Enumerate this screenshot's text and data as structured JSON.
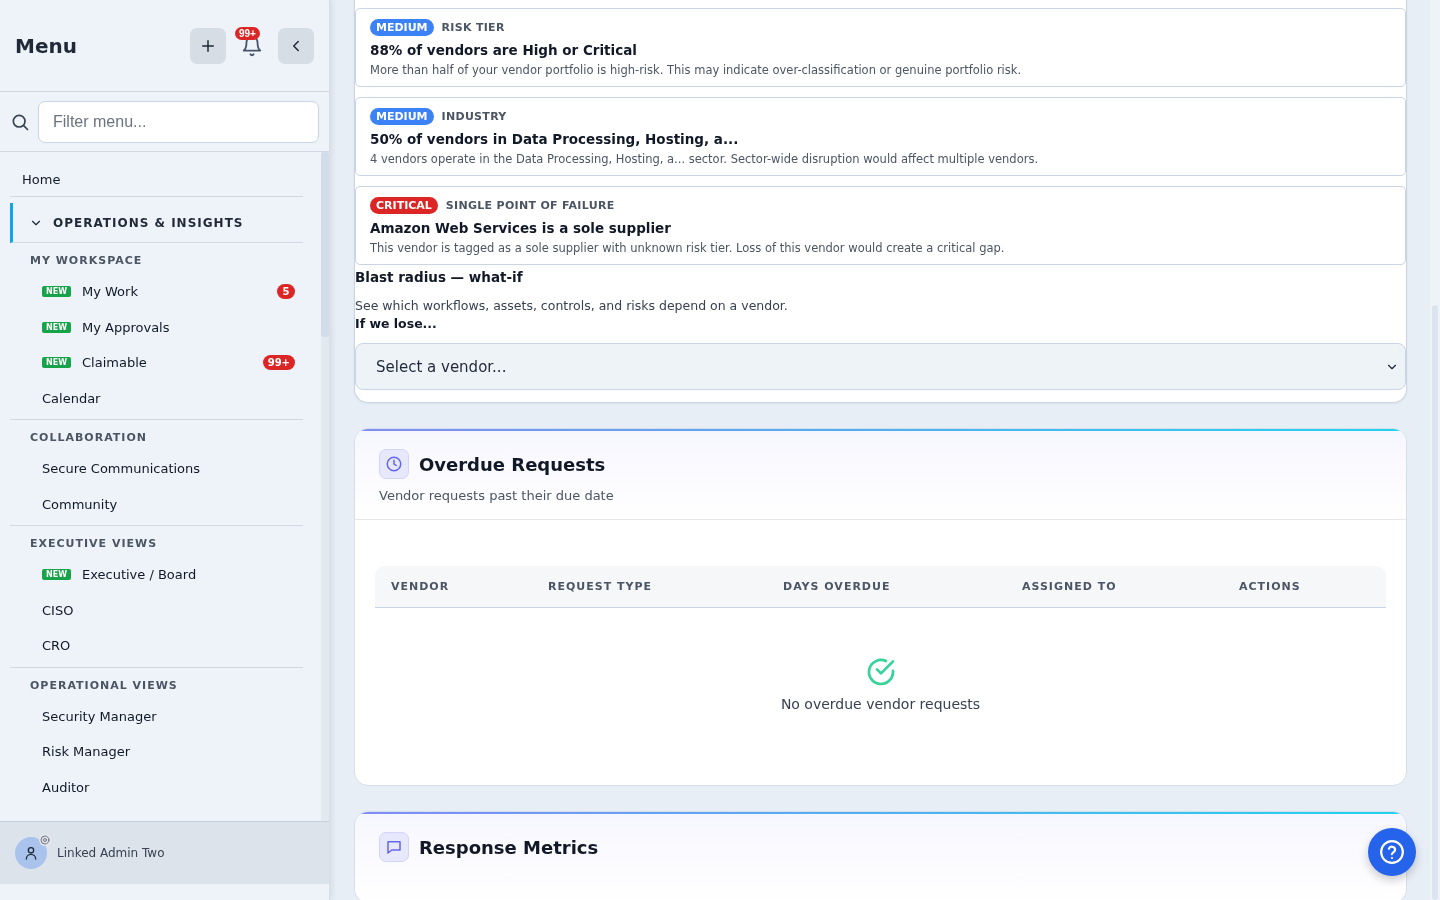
{
  "sidebar": {
    "title": "Menu",
    "notification_count": "99+",
    "search": {
      "placeholder": "Filter menu..."
    },
    "items": [
      {
        "label": "Home",
        "selected": false
      }
    ],
    "group": {
      "label": "OPERATIONS & INSIGHTS",
      "expanded": true,
      "sections": [
        {
          "heading": "MY WORKSPACE",
          "items": [
            {
              "label": "My Work",
              "tag": "NEW",
              "count": "5"
            },
            {
              "label": "My Approvals",
              "tag": "NEW"
            },
            {
              "label": "Claimable",
              "tag": "NEW",
              "count": "99+"
            },
            {
              "label": "Calendar"
            }
          ]
        },
        {
          "heading": "COLLABORATION",
          "items": [
            {
              "label": "Secure Communications"
            },
            {
              "label": "Community"
            }
          ]
        },
        {
          "heading": "EXECUTIVE VIEWS",
          "items": [
            {
              "label": "Executive / Board",
              "tag": "NEW"
            },
            {
              "label": "CISO"
            },
            {
              "label": "CRO"
            }
          ]
        },
        {
          "heading": "OPERATIONAL VIEWS",
          "items": [
            {
              "label": "Security Manager"
            },
            {
              "label": "Risk Manager"
            },
            {
              "label": "Auditor"
            }
          ]
        }
      ]
    },
    "user": {
      "name": "Linked Admin Two"
    }
  },
  "insights": [
    {
      "severity": "MEDIUM",
      "color": "#3b82f6",
      "category": "RISK TIER",
      "title": "88% of vendors are High or Critical",
      "description": "More than half of your vendor portfolio is high-risk. This may indicate over-classification or genuine portfolio risk."
    },
    {
      "severity": "MEDIUM",
      "color": "#3b82f6",
      "category": "INDUSTRY",
      "title": "50% of vendors in Data Processing, Hosting, a...",
      "description": "4 vendors operate in the Data Processing, Hosting, a... sector. Sector-wide disruption would affect multiple vendors."
    },
    {
      "severity": "CRITICAL",
      "color": "#dc2626",
      "category": "SINGLE POINT OF FAILURE",
      "title": "Amazon Web Services is a sole supplier",
      "description": "This vendor is tagged as a sole supplier with unknown risk tier. Loss of this vendor would create a critical gap."
    }
  ],
  "blast_radius": {
    "title": "Blast radius — what-if",
    "description": "See which workflows, assets, controls, and risks depend on a vendor.",
    "label": "If we lose...",
    "select": {
      "placeholder": "Select a vendor..."
    }
  },
  "overdue_requests": {
    "title": "Overdue Requests",
    "subtitle": "Vendor requests past their due date",
    "columns": [
      "VENDOR",
      "REQUEST TYPE",
      "DAYS OVERDUE",
      "ASSIGNED TO",
      "ACTIONS"
    ],
    "empty_message": "No overdue vendor requests"
  },
  "response_metrics": {
    "title": "Response Metrics"
  }
}
